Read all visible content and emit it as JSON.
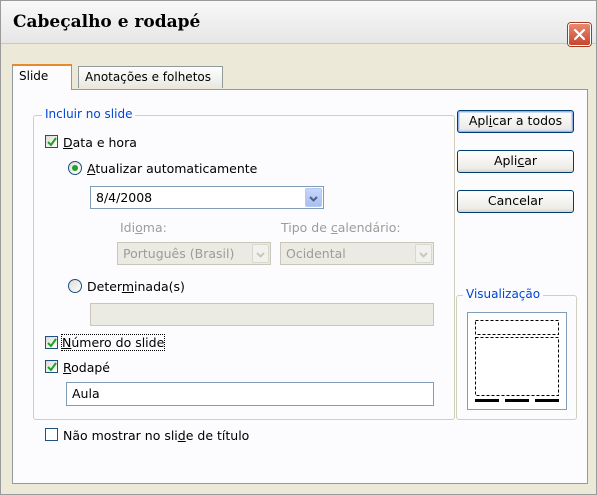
{
  "window": {
    "title": "Cabeçalho e rodapé",
    "close_icon": "close-icon"
  },
  "tabs": [
    {
      "label": "Slide",
      "active": true
    },
    {
      "label": "Anotações e folhetos",
      "active": false
    }
  ],
  "include_group": {
    "legend": "Incluir no slide",
    "date_time": {
      "label_pre": "",
      "label_u": "D",
      "label_post": "ata e hora",
      "checked": true
    },
    "auto_update": {
      "label_pre": "",
      "label_u": "A",
      "label_post": "tualizar automaticamente",
      "selected": true
    },
    "date_value": "8/4/2008",
    "language": {
      "label_pre": "Idi",
      "label_u": "o",
      "label_post": "ma:",
      "value": "Português (Brasil)"
    },
    "calendar_type": {
      "label_pre": "Tipo de ",
      "label_u": "c",
      "label_post": "alendário:",
      "value": "Ocidental"
    },
    "fixed": {
      "label_pre": "Deter",
      "label_u": "m",
      "label_post": "inada(s)",
      "selected": false,
      "value": ""
    },
    "slide_number": {
      "label_pre": "",
      "label_u": "N",
      "label_post": "úmero do slide",
      "checked": true
    },
    "footer": {
      "label_pre": "",
      "label_u": "R",
      "label_post": "odapé",
      "checked": true,
      "value": "Aula"
    }
  },
  "hide_on_title": {
    "label_pre": "Não mostrar no sli",
    "label_u": "d",
    "label_post": "e de título",
    "checked": false
  },
  "buttons": {
    "apply_all": {
      "pre": "Apl",
      "u": "i",
      "post": "car a todos"
    },
    "apply": {
      "pre": "Apli",
      "u": "c",
      "post": "ar"
    },
    "cancel": {
      "label": "Cancelar"
    }
  },
  "preview": {
    "legend": "Visualização"
  },
  "colors": {
    "accent": "#0046d5",
    "close": "#c9452b",
    "tab_highlight": "#e68b2c"
  }
}
